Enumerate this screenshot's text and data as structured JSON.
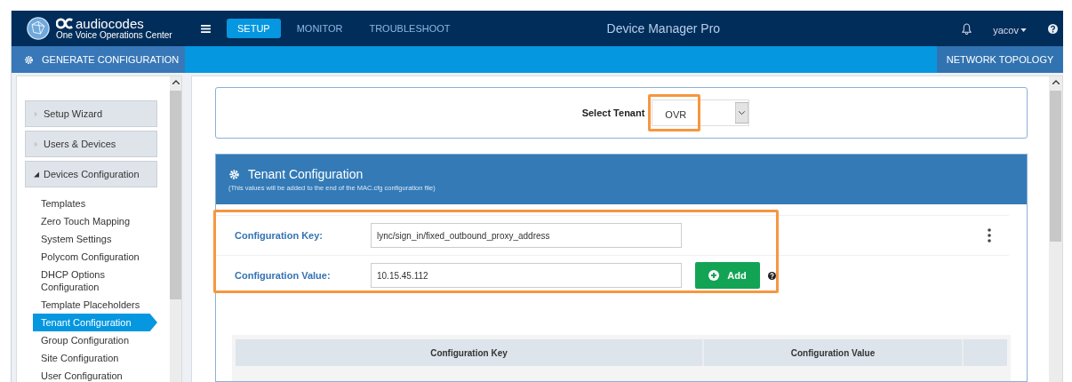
{
  "header": {
    "logo_text": "audiocodes",
    "logo_subtitle": "One Voice Operations Center",
    "nav_tabs": [
      {
        "label": "SETUP",
        "selected": true
      },
      {
        "label": "MONITOR",
        "selected": false
      },
      {
        "label": "TROUBLESHOOT",
        "selected": false
      }
    ],
    "app_title": "Device Manager Pro",
    "user": "yacov"
  },
  "subbar": {
    "left": "GENERATE CONFIGURATION",
    "right": "NETWORK TOPOLOGY"
  },
  "sidebar": {
    "sections": [
      {
        "label": "Setup Wizard",
        "expanded": false
      },
      {
        "label": "Users & Devices",
        "expanded": false
      },
      {
        "label": "Devices Configuration",
        "expanded": true
      }
    ],
    "items": [
      {
        "label": "Templates",
        "selected": false
      },
      {
        "label": "Zero Touch Mapping",
        "selected": false
      },
      {
        "label": "System Settings",
        "selected": false
      },
      {
        "label": "Polycom Configuration",
        "selected": false
      },
      {
        "label": "DHCP Options Configuration",
        "selected": false
      },
      {
        "label": "Template Placeholders",
        "selected": false
      },
      {
        "label": "Tenant Configuration",
        "selected": true
      },
      {
        "label": "Group Configuration",
        "selected": false
      },
      {
        "label": "Site Configuration",
        "selected": false
      },
      {
        "label": "User Configuration",
        "selected": false
      }
    ]
  },
  "tenant": {
    "label": "Select Tenant",
    "value": "OVR"
  },
  "panel": {
    "title": "Tenant Configuration",
    "subtitle": "(This values will be added to the end of the MAC.cfg configuration file)",
    "fields": [
      {
        "label": "Configuration Key:",
        "value": "lync/sign_in/fixed_outbound_proxy_address"
      },
      {
        "label": "Configuration Value:",
        "value": "10.15.45.112"
      }
    ],
    "add_button": "Add",
    "table": {
      "columns": [
        "Configuration Key",
        "Configuration Value"
      ]
    }
  }
}
